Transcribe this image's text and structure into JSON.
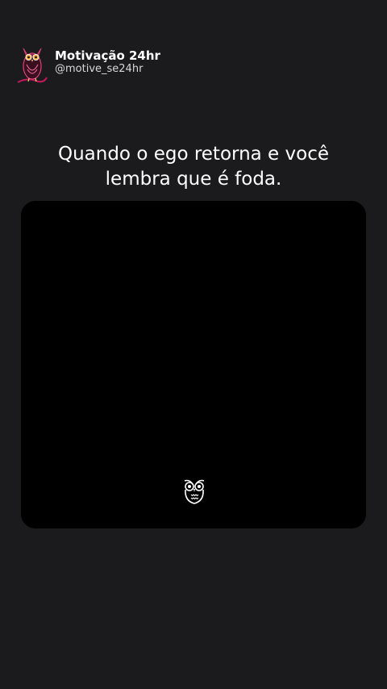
{
  "profile": {
    "name": "Motivação 24hr",
    "handle": "@motive_se24hr",
    "avatar_icon": "owl-icon"
  },
  "post": {
    "caption": "Quando o ego retorna e você lembra que é foda."
  },
  "media": {
    "watermark_icon": "owl-icon",
    "background": "#000000"
  },
  "colors": {
    "page_background": "#1b1b1d",
    "text": "#ffffff",
    "avatar_accent": "#c2185b"
  }
}
